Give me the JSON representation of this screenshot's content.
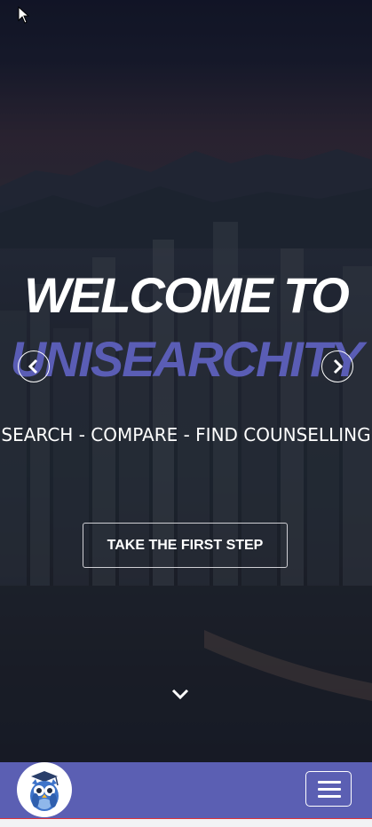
{
  "hero": {
    "title_line1": "WELCOME TO",
    "title_line2": "UNISEARCHITY",
    "tagline": "SEARCH - COMPARE - FIND COUNSELLING",
    "cta_label": "TAKE THE FIRST STEP",
    "prev_icon": "chevron-left-icon",
    "next_icon": "chevron-right-icon",
    "scroll_icon": "chevron-down-icon"
  },
  "navbar": {
    "logo_icon": "owl-graduate-logo",
    "menu_icon": "hamburger-menu-icon"
  },
  "colors": {
    "brand_accent": "#5a5db5",
    "navbar_bg": "#5b5fb3",
    "text": "#ffffff"
  }
}
